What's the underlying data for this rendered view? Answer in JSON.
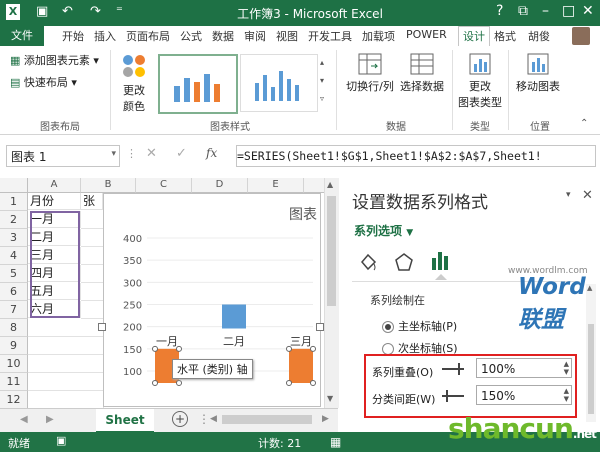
{
  "titlebar": {
    "title": "工作簿3 - Microsoft Excel",
    "app_icon": "X"
  },
  "tabs": [
    "文件",
    "开始",
    "插入",
    "页面布局",
    "公式",
    "数据",
    "审阅",
    "视图",
    "开发工具",
    "加载项",
    "POWER",
    "设计",
    "格式"
  ],
  "user": "胡俊",
  "ribbon": {
    "add_element": "添加图表元素",
    "quick_layout": "快速布局",
    "change_color_1": "更改",
    "change_color_2": "颜色",
    "group_layout": "图表布局",
    "group_styles": "图表样式",
    "switch_rowcol": "切换行/列",
    "select_data": "选择数据",
    "group_data": "数据",
    "change_type_1": "更改",
    "change_type_2": "图表类型",
    "group_type": "类型",
    "move_chart": "移动图表",
    "group_location": "位置"
  },
  "formula_bar": {
    "name_box": "图表 1",
    "fx": "fx",
    "formula": "=SERIES(Sheet1!$G$1,Sheet1!$A$2:$A$7,Sheet1!"
  },
  "grid": {
    "columns": [
      "A",
      "B",
      "C",
      "D",
      "E"
    ],
    "rows": [
      "1",
      "2",
      "3",
      "4",
      "5",
      "6",
      "7",
      "8",
      "9",
      "10",
      "11",
      "12"
    ],
    "a_values": [
      "月份",
      "一月",
      "二月",
      "三月",
      "四月",
      "五月",
      "六月"
    ],
    "b1": "张"
  },
  "chart": {
    "title_partial": "图表",
    "tooltip": "水平 (类别) 轴",
    "y_ticks": [
      "400",
      "350",
      "300",
      "250",
      "200",
      "150",
      "100"
    ]
  },
  "chart_data": {
    "type": "bar",
    "categories": [
      "一月",
      "二月",
      "三月"
    ],
    "values": [
      150,
      250,
      150
    ],
    "ylim": [
      100,
      400
    ],
    "colors": [
      "#ed7d31",
      "#5b9bd5",
      "#ed7d31"
    ]
  },
  "sheet_tab": "Sheet",
  "pane": {
    "title": "设置数据系列格式",
    "options": "系列选项",
    "section": "系列绘制在",
    "primary_axis": "主坐标轴(P)",
    "secondary_axis": "次坐标轴(S)",
    "overlap_label": "系列重叠(O)",
    "overlap_value": "100%",
    "gap_label": "分类间距(W)",
    "gap_value": "150%",
    "watermark": "Word联盟",
    "watermark_url": "www.wordlm.com"
  },
  "status": {
    "ready": "就绪",
    "count": "计数: 21",
    "brand": "shancun",
    "brand_suffix": ".net"
  }
}
